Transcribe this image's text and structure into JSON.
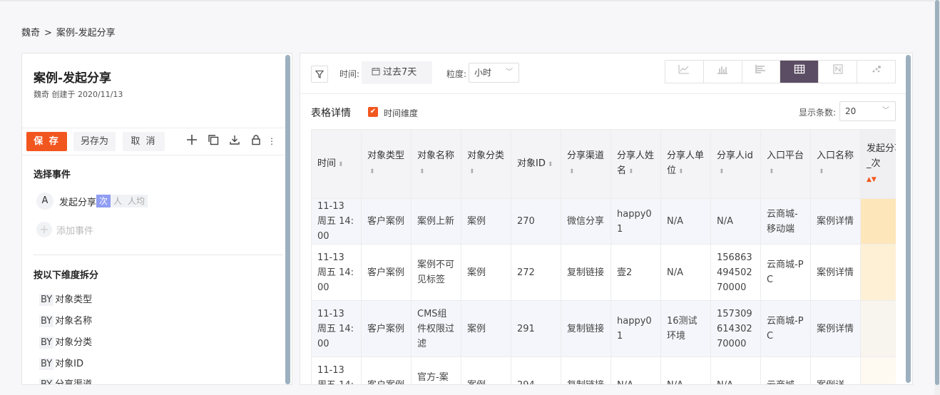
{
  "breadcrumb": {
    "root": "魏奇",
    "sep": ">",
    "current": "案例-发起分享"
  },
  "report": {
    "title": "案例-发起分享",
    "meta": "魏奇 创建于 2020/11/13"
  },
  "toolbar": {
    "save": "保 存",
    "save_as": "另存为",
    "cancel": "取 消",
    "icons": [
      "plus-icon",
      "copy-icon",
      "download-icon",
      "lock-icon",
      "more-icon"
    ]
  },
  "events": {
    "section_title": "选择事件",
    "items": [
      {
        "letter": "A",
        "name": "发起分享",
        "tags": [
          "次",
          "人",
          "人均"
        ],
        "active_tag": "次"
      }
    ],
    "add_label": "添加事件"
  },
  "dimensions": {
    "section_title": "按以下维度拆分",
    "by": "BY",
    "items": [
      "对象类型",
      "对象名称",
      "对象分类",
      "对象ID",
      "分享渠道"
    ]
  },
  "query": {
    "time_label": "时间:",
    "time_value": "过去7天",
    "granularity_label": "粒度:",
    "granularity_value": "小时",
    "chart_types": [
      "line-chart-icon",
      "bar-chart-icon",
      "horizontal-bar-icon",
      "table-icon",
      "number-icon",
      "scatter-icon"
    ],
    "active_chart": "table-icon"
  },
  "table_section": {
    "title": "表格详情",
    "time_dim_label": "时间维度",
    "time_dim_checked": true,
    "show_count_label": "显示条数:",
    "show_count_value": "20"
  },
  "table": {
    "columns": [
      "时间",
      "对象类型",
      "对象名称",
      "对象分类",
      "对象ID",
      "分享渠道",
      "分享人姓名",
      "分享人单位",
      "分享人id",
      "入口平台",
      "入口名称",
      "发起分享_次"
    ],
    "rows": [
      [
        "11-13 周五 14:00",
        "客户案例",
        "案例上新",
        "案例",
        "270",
        "微信分享",
        "happy01",
        "N/A",
        "N/A",
        "云商城-移动端",
        "案例详情",
        ""
      ],
      [
        "11-13 周五 14:00",
        "客户案例",
        "案例不可见标签",
        "案例",
        "272",
        "复制链接",
        "壹2",
        "N/A",
        "15686349450270000",
        "云商城-PC",
        "案例详情",
        ""
      ],
      [
        "11-13 周五 14:00",
        "客户案例",
        "CMS组件权限过滤",
        "案例",
        "291",
        "复制链接",
        "happy01",
        "16测试环境",
        "15730961430270000",
        "云商城-PC",
        "案例详情",
        ""
      ],
      [
        "11-13 周五 14:00",
        "客户案例",
        "官方-案例新详",
        "案例",
        "294",
        "复制链接",
        "N/A",
        "N/A",
        "N/A",
        "云商城-",
        "案例详",
        ""
      ]
    ]
  }
}
